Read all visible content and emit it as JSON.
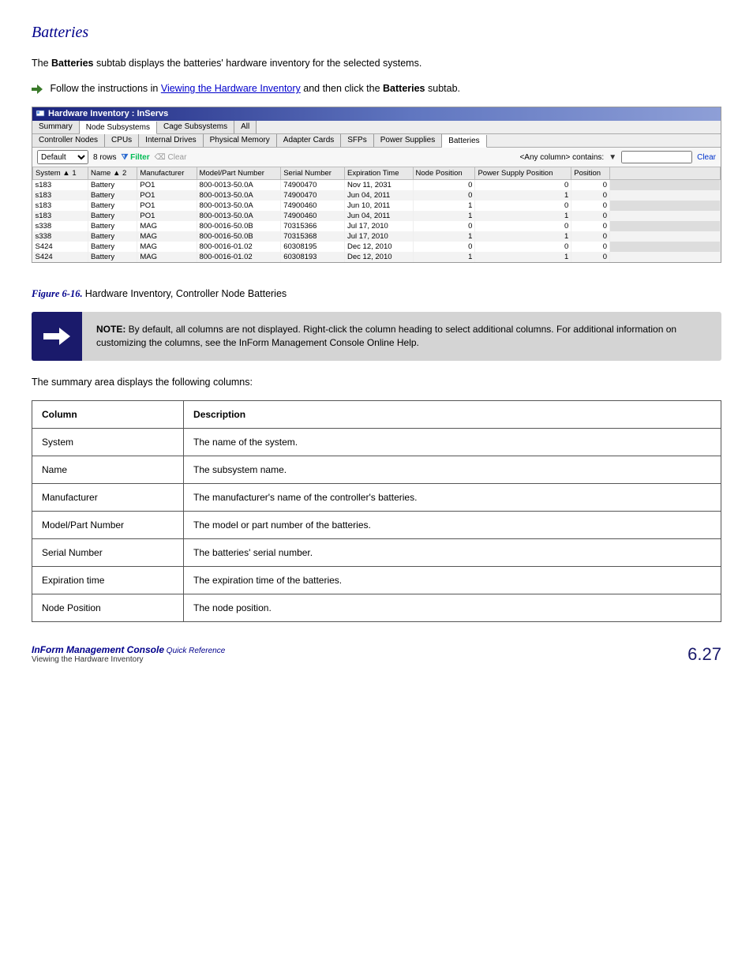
{
  "section_label": "Batteries",
  "intro_p1a": "The ",
  "intro_bold": "Batteries",
  "intro_p1b": " subtab displays the batteries' hardware inventory for the selected systems.",
  "bullet_text_a": "Follow the instructions in ",
  "bullet_link": "Viewing the Hardware Inventory",
  "bullet_text_b": " and then click the ",
  "bullet_bold": "Batteries",
  "bullet_text_c": " subtab.",
  "figure_caption_a": "Figure 6-16.  ",
  "figure_caption_b": "Hardware Inventory, Controller Node Batteries",
  "panel_title": "Hardware Inventory : InServs",
  "tabs1": [
    "Summary",
    "Node Subsystems",
    "Cage Subsystems",
    "All"
  ],
  "tabs1_active": 1,
  "tabs2": [
    "Controller Nodes",
    "CPUs",
    "Internal Drives",
    "Physical Memory",
    "Adapter Cards",
    "SFPs",
    "Power Supplies",
    "Batteries"
  ],
  "tabs2_active": 7,
  "toolbar": {
    "default_text": "Default",
    "rows_label": "8 rows",
    "filter_label": "Filter",
    "clear_small": "Clear",
    "contains_label": "<Any column> contains:",
    "clear_label": "Clear"
  },
  "grid_headers": [
    "System ▲ 1",
    "Name ▲ 2",
    "Manufacturer",
    "Model/Part Number",
    "Serial Number",
    "Expiration Time",
    "Node Position",
    "Power Supply Position",
    "Position",
    ""
  ],
  "grid_rows": [
    {
      "system": "s183",
      "name": "Battery",
      "manufacturer": "PO1",
      "model": "800-0013-50.0A",
      "serial": "74900470",
      "exp": "Nov 11, 2031",
      "nodepos": "0",
      "pspos": "0",
      "pos": "0"
    },
    {
      "system": "s183",
      "name": "Battery",
      "manufacturer": "PO1",
      "model": "800-0013-50.0A",
      "serial": "74900470",
      "exp": "Jun 04, 2011",
      "nodepos": "0",
      "pspos": "1",
      "pos": "0"
    },
    {
      "system": "s183",
      "name": "Battery",
      "manufacturer": "PO1",
      "model": "800-0013-50.0A",
      "serial": "74900460",
      "exp": "Jun 10, 2011",
      "nodepos": "1",
      "pspos": "0",
      "pos": "0"
    },
    {
      "system": "s183",
      "name": "Battery",
      "manufacturer": "PO1",
      "model": "800-0013-50.0A",
      "serial": "74900460",
      "exp": "Jun 04, 2011",
      "nodepos": "1",
      "pspos": "1",
      "pos": "0"
    },
    {
      "system": "s338",
      "name": "Battery",
      "manufacturer": "MAG",
      "model": "800-0016-50.0B",
      "serial": "70315366",
      "exp": "Jul 17, 2010",
      "nodepos": "0",
      "pspos": "0",
      "pos": "0"
    },
    {
      "system": "s338",
      "name": "Battery",
      "manufacturer": "MAG",
      "model": "800-0016-50.0B",
      "serial": "70315368",
      "exp": "Jul 17, 2010",
      "nodepos": "1",
      "pspos": "1",
      "pos": "0"
    },
    {
      "system": "S424",
      "name": "Battery",
      "manufacturer": "MAG",
      "model": "800-0016-01.02",
      "serial": "60308195",
      "exp": "Dec 12, 2010",
      "nodepos": "0",
      "pspos": "0",
      "pos": "0"
    },
    {
      "system": "S424",
      "name": "Battery",
      "manufacturer": "MAG",
      "model": "800-0016-01.02",
      "serial": "60308193",
      "exp": "Dec 12, 2010",
      "nodepos": "1",
      "pspos": "1",
      "pos": "0"
    }
  ],
  "note_label": "NOTE:",
  "note_text": " By default, all columns are not displayed. Right-click the column heading to select additional columns. For additional information on customizing the columns, see the InForm Management Console Online Help.",
  "summary_intro": "The summary area displays the following columns:",
  "col_table_h1": "Column",
  "col_table_h2": "Description",
  "col_rows": [
    {
      "c": "System",
      "d": "The name of the system."
    },
    {
      "c": "Name",
      "d": "The subsystem name."
    },
    {
      "c": "Manufacturer",
      "d": "The manufacturer's name of the controller's batteries."
    },
    {
      "c": "Model/Part Number",
      "d": "The model or part number of the batteries."
    },
    {
      "c": "Serial Number",
      "d": "The batteries' serial number."
    },
    {
      "c": "Expiration time",
      "d": "The expiration time of the batteries."
    },
    {
      "c": "Node Position",
      "d": "The node position."
    }
  ],
  "footer_left_bold": "InForm Management Console",
  "footer_left_text": " Quick Reference",
  "footer_chapter": "Viewing the Hardware Inventory",
  "page_number": "6.27"
}
